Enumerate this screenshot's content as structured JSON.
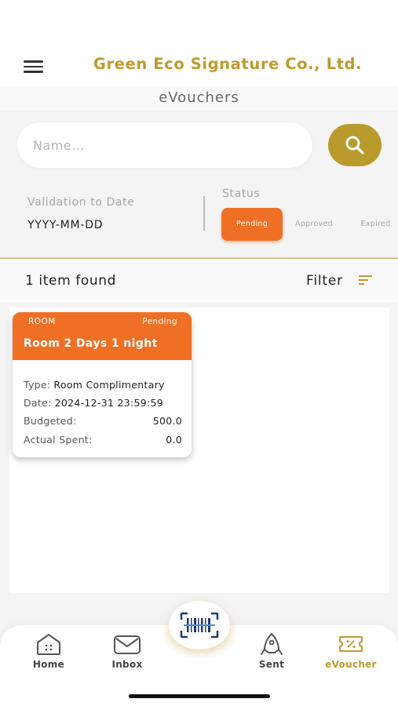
{
  "header": {
    "company_name": "Green Eco Signature Co., Ltd.",
    "menu_icon": "hamburger-menu-icon",
    "subtitle": "eVouchers"
  },
  "search": {
    "placeholder": "Name...",
    "value": "",
    "button_icon": "search-icon"
  },
  "filters": {
    "validation_label": "Validation to Date",
    "date_value": "YYYY-MM-DD",
    "status_label": "Status",
    "statuses": [
      "Pending",
      "Approved",
      "Expired"
    ],
    "selected_status": "Pending"
  },
  "results": {
    "count_text": "1 item found",
    "filter_label": "Filter",
    "filter_icon": "sort-filter-icon"
  },
  "vouchers": [
    {
      "category": "ROOM",
      "status": "Pending",
      "title": "Room 2 Days 1 night",
      "type_label": "Type:",
      "type_value": "Room Complimentary",
      "date_label": "Date:",
      "date_value": "2024-12-31 23:59:59",
      "budgeted_label": "Budgeted:",
      "budgeted_value": "500.0",
      "actual_label": "Actual Spent:",
      "actual_value": "0.0"
    }
  ],
  "nav": {
    "items": [
      {
        "label": "Home",
        "icon": "home-icon"
      },
      {
        "label": "Inbox",
        "icon": "mail-icon"
      },
      {
        "label": "Sent",
        "icon": "send-icon"
      },
      {
        "label": "eVoucher",
        "icon": "voucher-icon"
      }
    ],
    "active": "eVoucher",
    "scan_icon": "barcode-scan-icon"
  },
  "colors": {
    "brand_gold": "#bf9a2d",
    "accent_orange": "#ef6f25",
    "search_button": "#b99a2c"
  }
}
